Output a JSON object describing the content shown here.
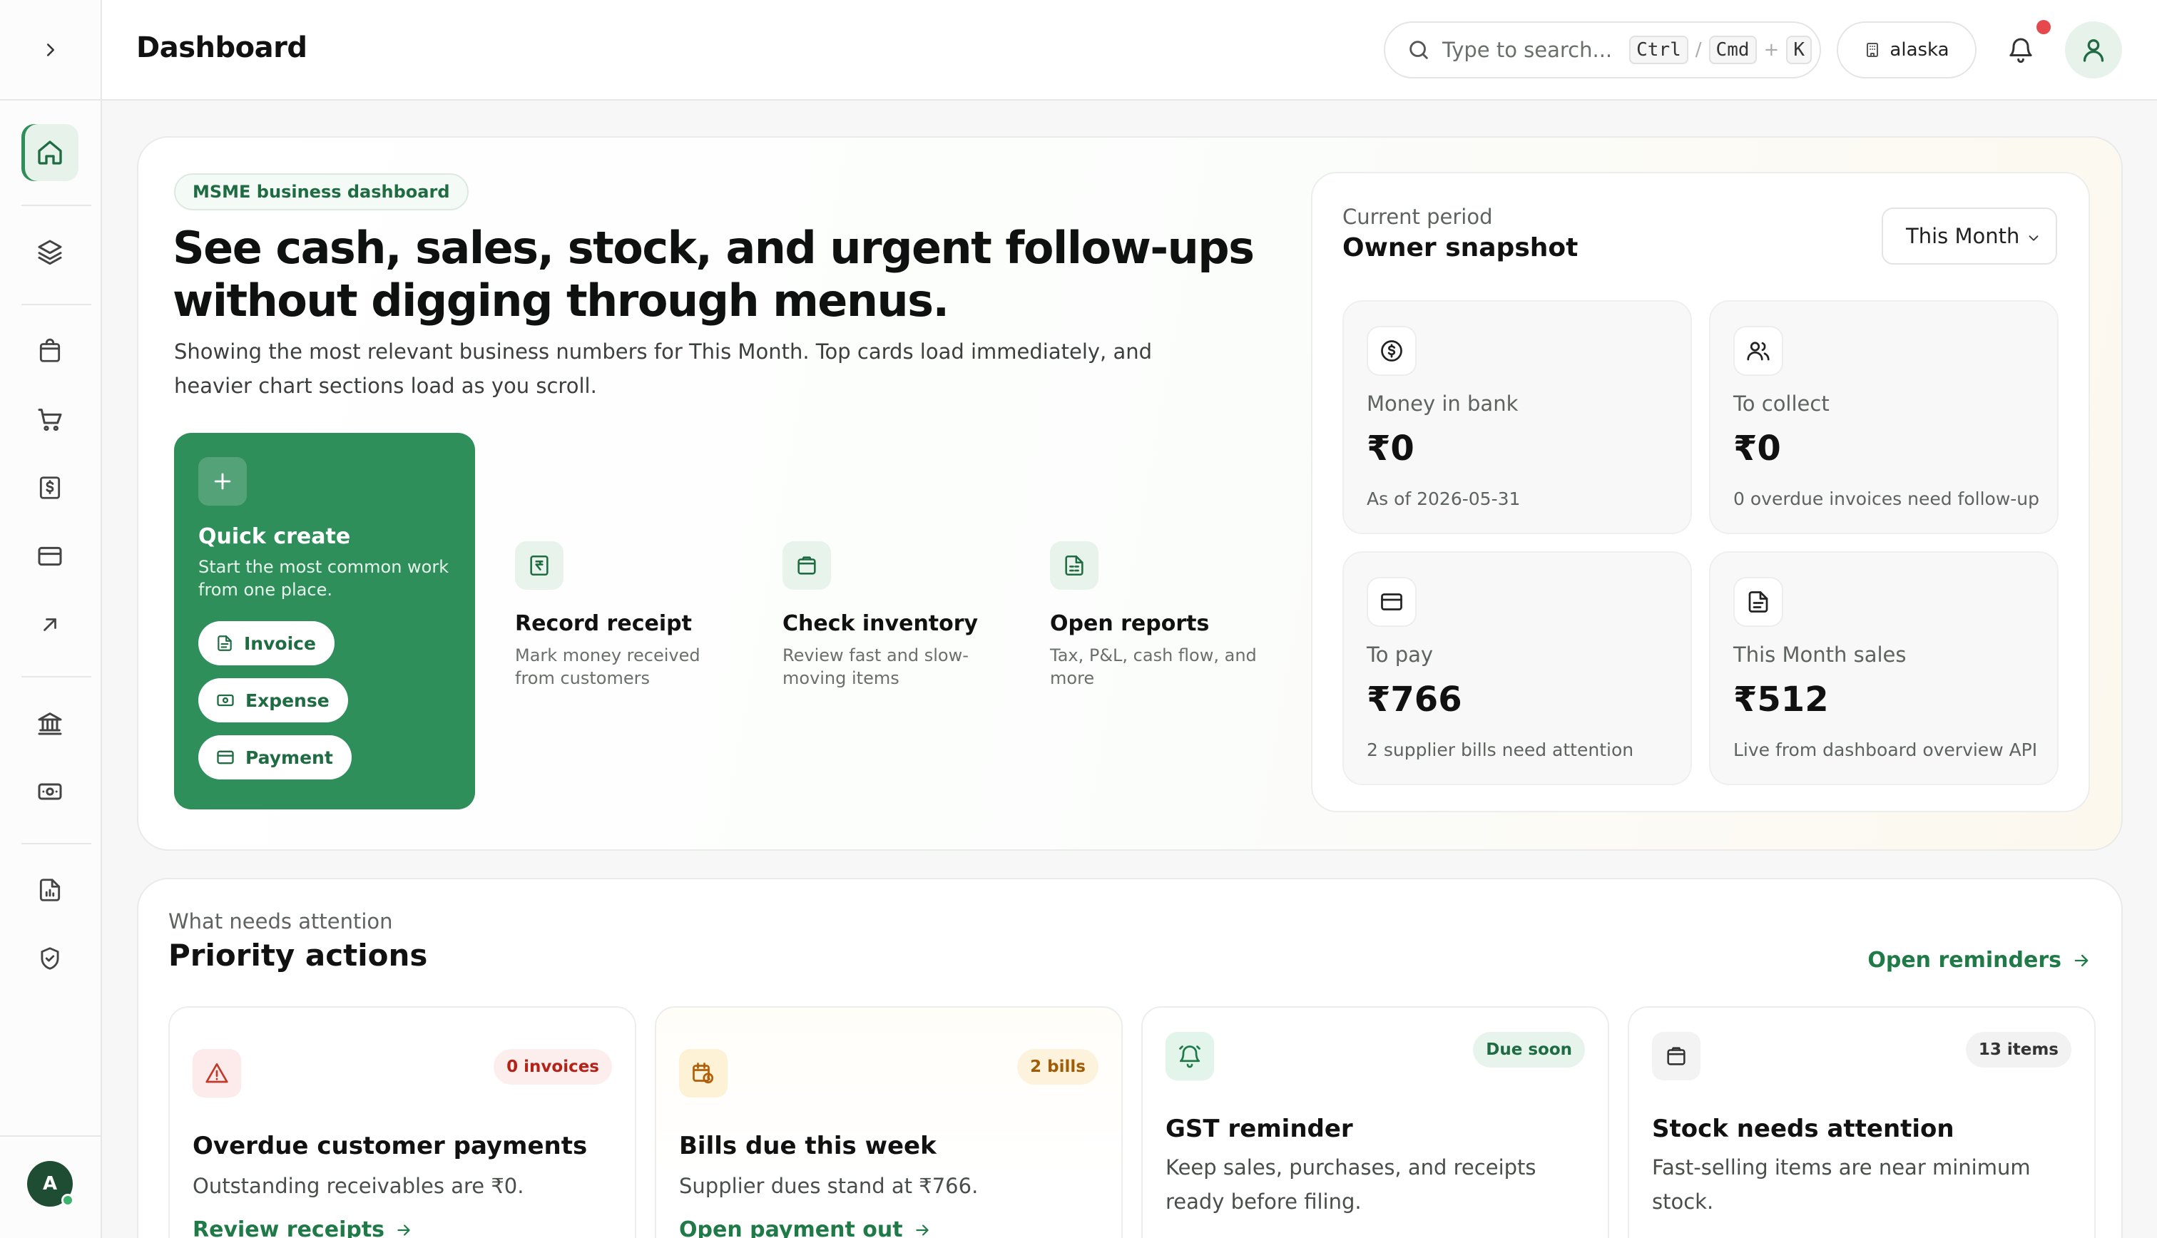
{
  "header": {
    "title": "Dashboard",
    "search_placeholder": "Type to search...",
    "shortcut_ctrl": "Ctrl",
    "shortcut_sep": "/",
    "shortcut_cmd": "Cmd",
    "shortcut_plus": "+",
    "shortcut_key": "K",
    "workspace": "alaska"
  },
  "sidebar": {
    "items": [
      {
        "icon": "home-icon",
        "active": true
      },
      {
        "icon": "layers-icon"
      },
      {
        "icon": "shopping-bag-icon"
      },
      {
        "icon": "cart-icon"
      },
      {
        "icon": "invoice-dollar-icon"
      },
      {
        "icon": "card-icon"
      },
      {
        "icon": "arrow-up-right-icon"
      },
      {
        "icon": "bank-icon"
      },
      {
        "icon": "cash-icon"
      },
      {
        "icon": "report-icon"
      },
      {
        "icon": "shield-check-icon"
      }
    ],
    "avatar_initial": "A"
  },
  "hero": {
    "badge": "MSME business dashboard",
    "heading": "See cash, sales, stock, and urgent follow-ups without digging through menus.",
    "subtext": "Showing the most relevant business numbers for This Month. Top cards load immediately, and heavier chart sections load as you scroll.",
    "quick_create": {
      "title": "Quick create",
      "desc": "Start the most common work from one place.",
      "buttons": [
        "Invoice",
        "Expense",
        "Payment"
      ]
    },
    "actions": [
      {
        "title": "Record receipt",
        "desc": "Mark money received from customers"
      },
      {
        "title": "Check inventory",
        "desc": "Review fast and slow-moving items"
      },
      {
        "title": "Open reports",
        "desc": "Tax, P&L, cash flow, and more"
      }
    ]
  },
  "snapshot": {
    "kicker": "Current period",
    "title": "Owner snapshot",
    "period": "This Month",
    "stats": [
      {
        "label": "Money in bank",
        "value": "₹0",
        "note": "As of 2026-05-31"
      },
      {
        "label": "To collect",
        "value": "₹0",
        "note": "0 overdue invoices need follow-up"
      },
      {
        "label": "To pay",
        "value": "₹766",
        "note": "2 supplier bills need attention"
      },
      {
        "label": "This Month sales",
        "value": "₹512",
        "note": "Live from dashboard overview API"
      }
    ]
  },
  "priority": {
    "kicker": "What needs attention",
    "title": "Priority actions",
    "link": "Open reminders",
    "cards": [
      {
        "badge": "0 invoices",
        "title": "Overdue customer payments",
        "desc": "Outstanding receivables are ₹0.",
        "link": "Review receipts"
      },
      {
        "badge": "2 bills",
        "title": "Bills due this week",
        "desc": "Supplier dues stand at ₹766.",
        "link": "Open payment out"
      },
      {
        "badge": "Due soon",
        "title": "GST reminder",
        "desc": "Keep sales, purchases, and receipts ready before filing."
      },
      {
        "badge": "13 items",
        "title": "Stock needs attention",
        "desc": "Fast-selling items are near minimum stock."
      }
    ]
  },
  "colors": {
    "accent": "#2f8f5b",
    "accent_dark": "#1f6b42",
    "danger": "#c0392b",
    "warning": "#b25e09",
    "notification": "#e5484d"
  }
}
